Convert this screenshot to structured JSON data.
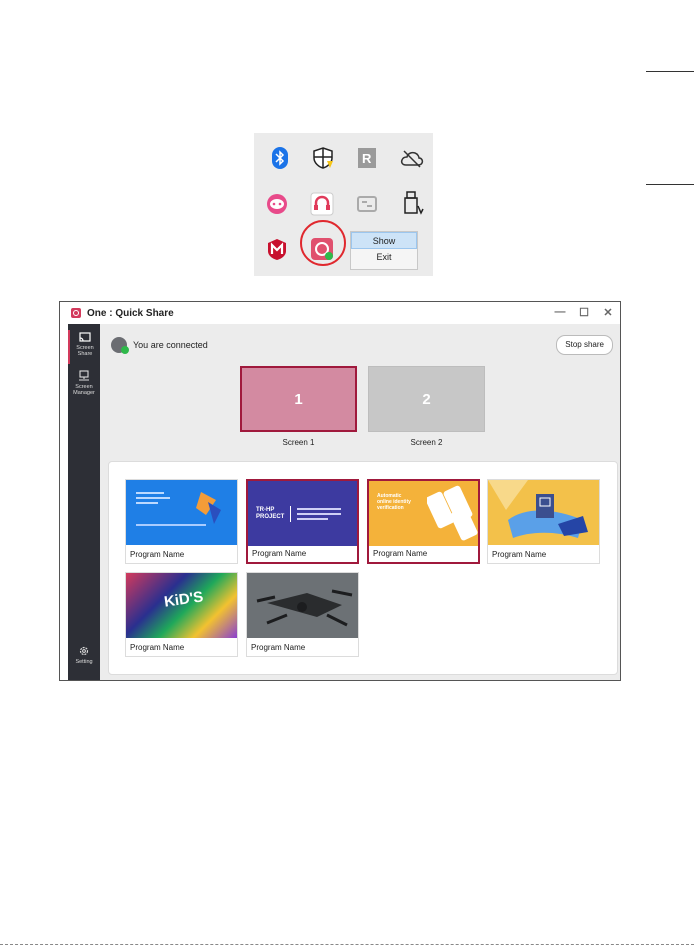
{
  "tray": {
    "context_menu": [
      "Show",
      "Exit"
    ]
  },
  "window": {
    "title": "One : Quick Share",
    "sidebar": [
      {
        "label_line1": "Screen",
        "label_line2": "Share"
      },
      {
        "label_line1": "Screen",
        "label_line2": "Manager"
      },
      {
        "label_line1": "Setting",
        "label_line2": ""
      }
    ],
    "status_text": "You are connected",
    "stop_button": "Stop share",
    "screens": [
      {
        "number": "1",
        "label": "Screen 1",
        "selected": true
      },
      {
        "number": "2",
        "label": "Screen 2",
        "selected": false
      }
    ],
    "programs": [
      {
        "label": "Program Name",
        "selected": false
      },
      {
        "label": "Program Name",
        "selected": true,
        "thumb_text_1": "TR-HP",
        "thumb_text_2": "PROJECT"
      },
      {
        "label": "Program Name",
        "selected": true,
        "thumb_text_1": "Automatic",
        "thumb_text_2": "online identity",
        "thumb_text_3": "verification"
      },
      {
        "label": "Program Name",
        "selected": false
      },
      {
        "label": "Program Name",
        "selected": false,
        "thumb_text_1": "KiD'S"
      },
      {
        "label": "Program Name",
        "selected": false
      }
    ]
  },
  "colors": {
    "accent": "#a0193c",
    "sidebar": "#2d2f36",
    "connected": "#2eb84a"
  }
}
